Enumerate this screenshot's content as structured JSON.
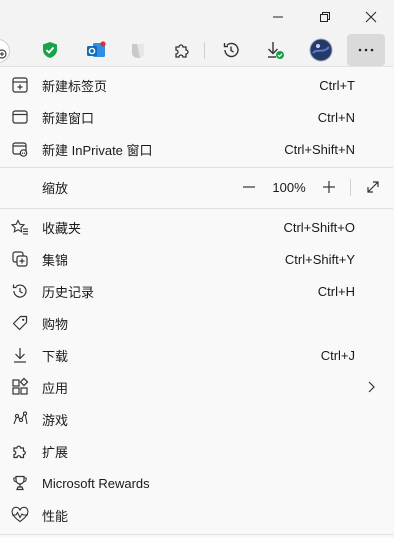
{
  "window_controls": {
    "minimize_icon": "minimize-icon",
    "maximize_icon": "restore-icon",
    "close_icon": "close-icon"
  },
  "toolbar": {
    "items": [
      "profile-icon",
      "adblock-shield-icon",
      "outlook-icon",
      "extension-icon",
      "extensions-puzzle-icon",
      "history-icon",
      "downloads-icon",
      "avatar",
      "more-icon"
    ]
  },
  "menu": {
    "new_tab": {
      "label": "新建标签页",
      "shortcut": "Ctrl+T"
    },
    "new_window": {
      "label": "新建窗口",
      "shortcut": "Ctrl+N"
    },
    "new_inprivate": {
      "label": "新建 InPrivate 窗口",
      "shortcut": "Ctrl+Shift+N"
    },
    "zoom": {
      "label": "缩放",
      "value": "100%"
    },
    "favorites": {
      "label": "收藏夹",
      "shortcut": "Ctrl+Shift+O"
    },
    "collections": {
      "label": "集锦",
      "shortcut": "Ctrl+Shift+Y"
    },
    "history": {
      "label": "历史记录",
      "shortcut": "Ctrl+H"
    },
    "shopping": {
      "label": "购物"
    },
    "downloads": {
      "label": "下载",
      "shortcut": "Ctrl+J"
    },
    "apps": {
      "label": "应用"
    },
    "games": {
      "label": "游戏"
    },
    "extensions": {
      "label": "扩展"
    },
    "rewards": {
      "label": "Microsoft Rewards"
    },
    "performance": {
      "label": "性能"
    }
  },
  "colors": {
    "accent_green": "#1aa34a",
    "outlook_blue": "#0f6cbd",
    "badge_green": "#15a13b",
    "menu_bg": "#f9f9f9",
    "chrome_bg": "#f3f3f3"
  }
}
